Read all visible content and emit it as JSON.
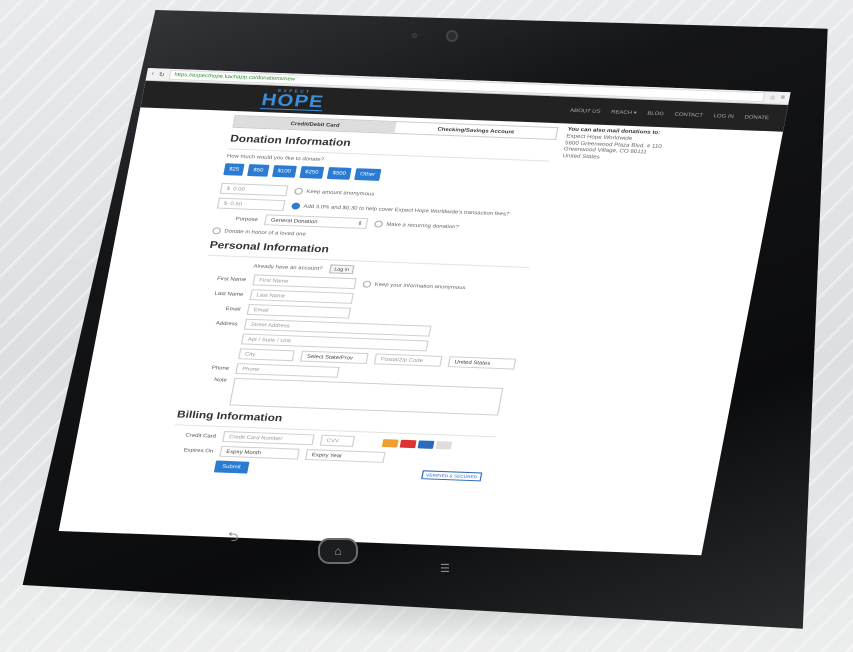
{
  "browser": {
    "url": "https://expecthope.kachapp.co/donations/new"
  },
  "nav": {
    "logo": "HOPE",
    "logo_sub": "EXPECT",
    "menu": [
      "ABOUT US",
      "REACH ▾",
      "BLOG",
      "CONTACT",
      "LOG IN",
      "DONATE"
    ]
  },
  "tabs": [
    "Credit/Debit Card",
    "Checking/Savings Account"
  ],
  "mail": {
    "heading": "You can also mail donations to:",
    "lines": [
      "Expect Hope Worldwide",
      "5600 Greenwood Plaza Blvd. # 110",
      "Greenwood Village, CO 80111",
      "United States"
    ]
  },
  "donation": {
    "title": "Donation Information",
    "question": "How much would you like to donate?",
    "amounts": [
      "$25",
      "$50",
      "$100",
      "$250",
      "$500",
      "Other"
    ],
    "amount_value": "0.00",
    "fee_value": "0.50",
    "keep_anonymous": "Keep amount anonymous",
    "fee_note": "Add 3.0% and $0.30 to help cover Expect Hope Worldwide's transaction fees?",
    "purpose_label": "Purpose",
    "purpose_value": "General Donation",
    "recurring": "Make a recurring donation?",
    "honor": "Donate in honor of a loved one"
  },
  "personal": {
    "title": "Personal Information",
    "account_q": "Already have an account?",
    "login": "Log in",
    "first_label": "First Name",
    "first_ph": "First Name",
    "keep_private": "Keep your information anonymous",
    "last_label": "Last Name",
    "last_ph": "Last Name",
    "email_label": "Email",
    "email_ph": "Email",
    "address_label": "Address",
    "street_ph": "Street Address",
    "apt_ph": "Apt / Suite / Unit",
    "city_ph": "City",
    "state_ph": "Select State/Prov",
    "zip_ph": "Postal/Zip Code",
    "country": "United States",
    "phone_label": "Phone",
    "phone_ph": "Phone",
    "note_label": "Note"
  },
  "billing": {
    "title": "Billing Information",
    "cc_label": "Credit Card",
    "cc_ph": "Credit Card Number",
    "cvv_ph": "CVV",
    "exp_label": "Expires On",
    "month_ph": "Expiry Month",
    "year_ph": "Expiry Year",
    "submit": "Submit",
    "secure": "VERIFIED & SECURED"
  },
  "colors": {
    "accent": "#2a7bd1",
    "nav_bg": "#222222"
  }
}
